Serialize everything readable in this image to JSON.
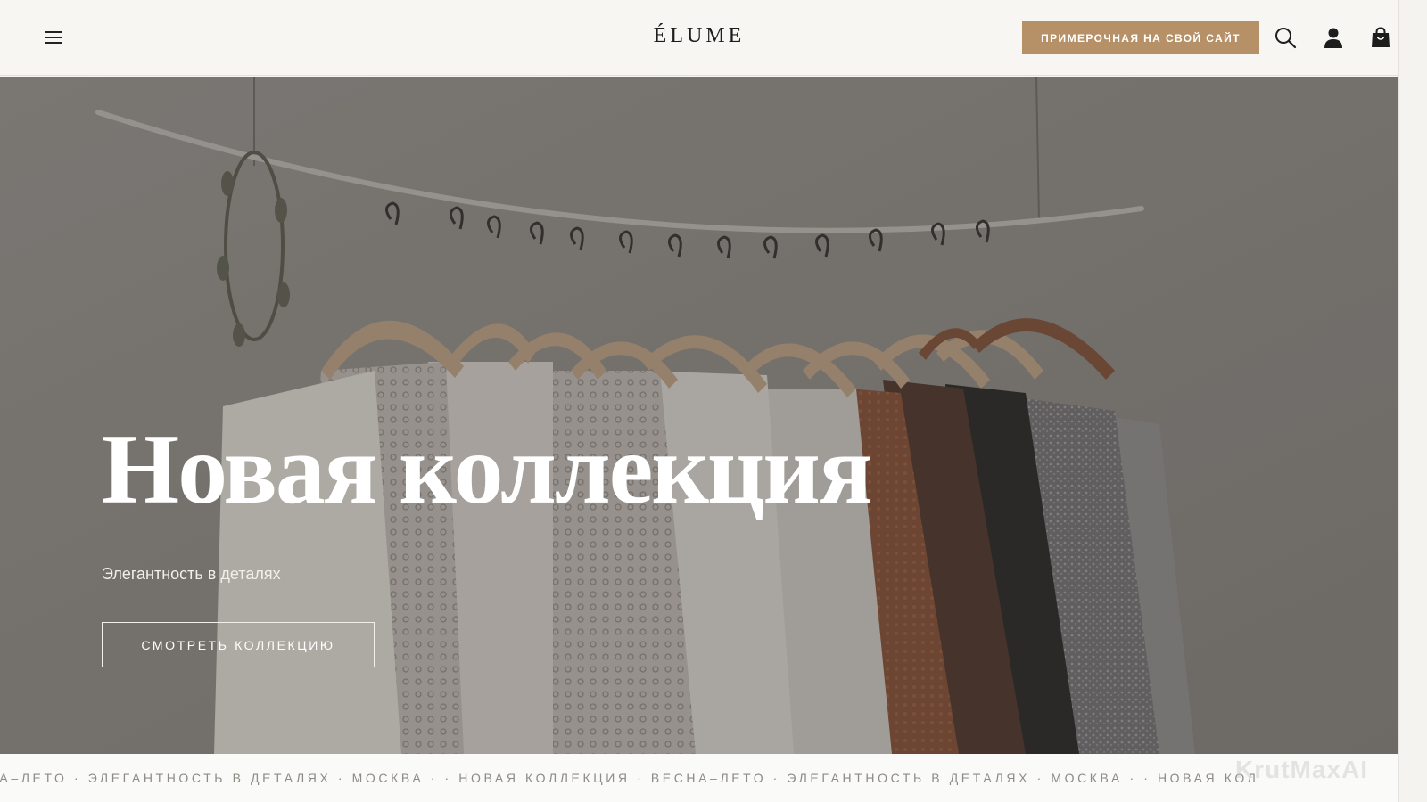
{
  "header": {
    "logo": "ÉLUME",
    "try_button": "ПРИМЕРОЧНАЯ НА СВОЙ САЙТ",
    "icons": [
      "menu-icon",
      "search-icon",
      "user-icon",
      "bag-icon"
    ]
  },
  "hero": {
    "title": "Новая коллекция",
    "subtitle": "Элегантность в деталях",
    "cta": "СМОТРЕТЬ КОЛЛЕКЦИЮ"
  },
  "marquee": {
    "text": "СНА–ЛЕТО · ЭЛЕГАНТНОСТЬ В ДЕТАЛЯХ · МОСКВА · · НОВАЯ КОЛЛЕКЦИЯ · ВЕСНА–ЛЕТО · ЭЛЕГАНТНОСТЬ В ДЕТАЛЯХ · МОСКВА · · НОВАЯ КОЛ"
  },
  "watermark": "KrutMaxAI",
  "colors": {
    "accent": "#b69168",
    "header_bg": "#f7f6f3",
    "text_dark": "#1d1d1d",
    "marquee_text": "#8f8a84"
  }
}
